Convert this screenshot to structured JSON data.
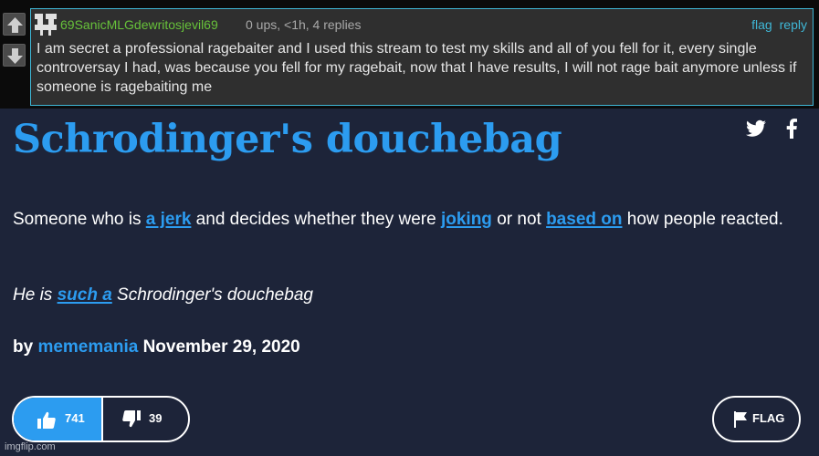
{
  "comment": {
    "username": "69SanicMLGdewritosjevil69",
    "meta": "0 ups, <1h, 4 replies",
    "flag_label": "flag",
    "reply_label": "reply",
    "text": "I am secret a professional ragebaiter and I used this stream to test my skills and all of you fell for it, every single controversay I had, was because you fell for my ragebait, now that I have results, I will not rage bait anymore unless if someone is ragebaiting me"
  },
  "entry": {
    "word": "Schrodinger's douchebag",
    "definition": {
      "part1": "Someone who is ",
      "link1": "a jerk",
      "part2": " and decides whether they were ",
      "link2": "joking",
      "part3": " or not ",
      "link3": "based on",
      "part4": " how people reacted."
    },
    "example": {
      "part1": "He is ",
      "link1": "such a",
      "part2": " Schrodinger's douchebag"
    },
    "byline": {
      "prefix": "by ",
      "author": "mememania",
      "date": " November 29, 2020"
    },
    "upvotes": "741",
    "downvotes": "39",
    "flag_label": "FLAG"
  },
  "watermark": "imgflip.com",
  "colors": {
    "background": "#1d2439",
    "accent": "#2c9cf0",
    "comment_border": "#3fb7d6",
    "username_green": "#67c23a"
  },
  "icons": [
    "arrow-up-icon",
    "arrow-down-icon",
    "pixel-avatar-icon",
    "twitter-icon",
    "facebook-icon",
    "thumbs-up-icon",
    "thumbs-down-icon",
    "flag-icon"
  ]
}
